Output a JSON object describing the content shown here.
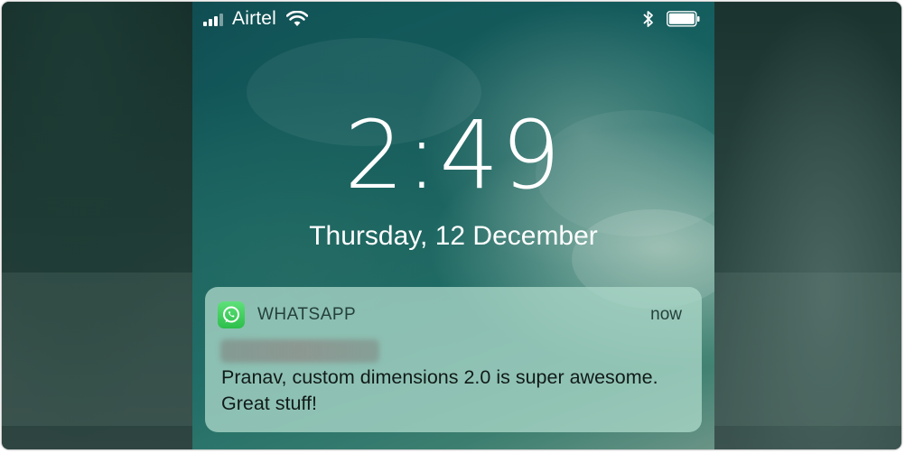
{
  "status_bar": {
    "carrier": "Airtel",
    "signal_icon": "cellular-signal-icon",
    "wifi_icon": "wifi-icon",
    "bluetooth_icon": "bluetooth-icon",
    "battery_icon": "battery-icon"
  },
  "lock_screen": {
    "time": "2:49",
    "date": "Thursday, 12 December"
  },
  "notification": {
    "app_icon": "whatsapp-icon",
    "app_name": "WHATSAPP",
    "time_ago": "now",
    "message": "Pranav, custom dimensions 2.0 is super awesome. Great stuff!"
  },
  "colors": {
    "whatsapp_green": "#2cbf4a",
    "notification_bg": "#aad7c8"
  }
}
